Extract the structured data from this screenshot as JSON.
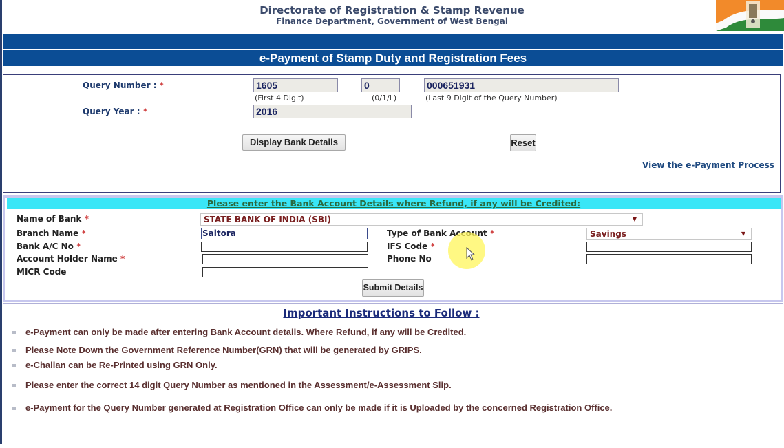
{
  "header": {
    "title": "Directorate of Registration & Stamp Revenue",
    "subtitle": "Finance Department, Government of West Bengal",
    "emblem": "state-emblem-flag-logo"
  },
  "banner": {
    "title": "e-Payment of Stamp Duty and Registration Fees"
  },
  "query": {
    "number_label": "Query Number :",
    "year_label": "Query Year :",
    "required_mark": "*",
    "first4_value": "1605",
    "first4_hint": "(First 4 Digit)",
    "type_value": "0",
    "type_hint": "(0/1/L)",
    "last9_value": "000651931",
    "last9_hint": "(Last 9 Digit of the Query Number)",
    "year_value": "2016",
    "display_button": "Display Bank Details",
    "reset_button": "Reset",
    "process_link": "View the e-Payment Process"
  },
  "bank": {
    "heading": "Please enter the Bank Account Details where Refund, if any will be Credited:",
    "required_mark": "*",
    "bank_name_label": "Name of Bank",
    "bank_name_value": "STATE BANK OF INDIA (SBI)",
    "branch_label": "Branch Name",
    "branch_value": "Saltora",
    "account_no_label": "Bank A/C No",
    "account_no_value": "",
    "holder_label": "Account Holder Name",
    "holder_value": "",
    "micr_label": "MICR Code",
    "micr_value": "",
    "account_type_label": "Type of Bank Account",
    "account_type_value": "Savings",
    "ifsc_label": "IFS Code",
    "ifsc_value": "",
    "phone_label": "Phone No",
    "phone_value": "",
    "submit_button": "Submit Details",
    "dropdown_arrow": "▼"
  },
  "instructions": {
    "title": "Important Instructions to Follow :",
    "items": [
      "e-Payment can only be made after entering Bank Account details. Where Refund, if any will be Credited.",
      "Please Note Down the Government Reference Number(GRN) that will be generated by GRIPS.",
      "e-Challan can be Re-Printed using GRN Only.",
      "Please enter the correct 14 digit Query Number as mentioned in the Assessment/e-Assessment Slip.",
      "e-Payment for the Query Number generated at Registration Office can only be made if it is Uploaded by the concerned Registration Office."
    ]
  },
  "colors": {
    "banner_blue": "#0b4d95",
    "heading_cyan": "#3ae6f7",
    "label_navy": "#1f3b6e",
    "required_red": "#d04040"
  }
}
